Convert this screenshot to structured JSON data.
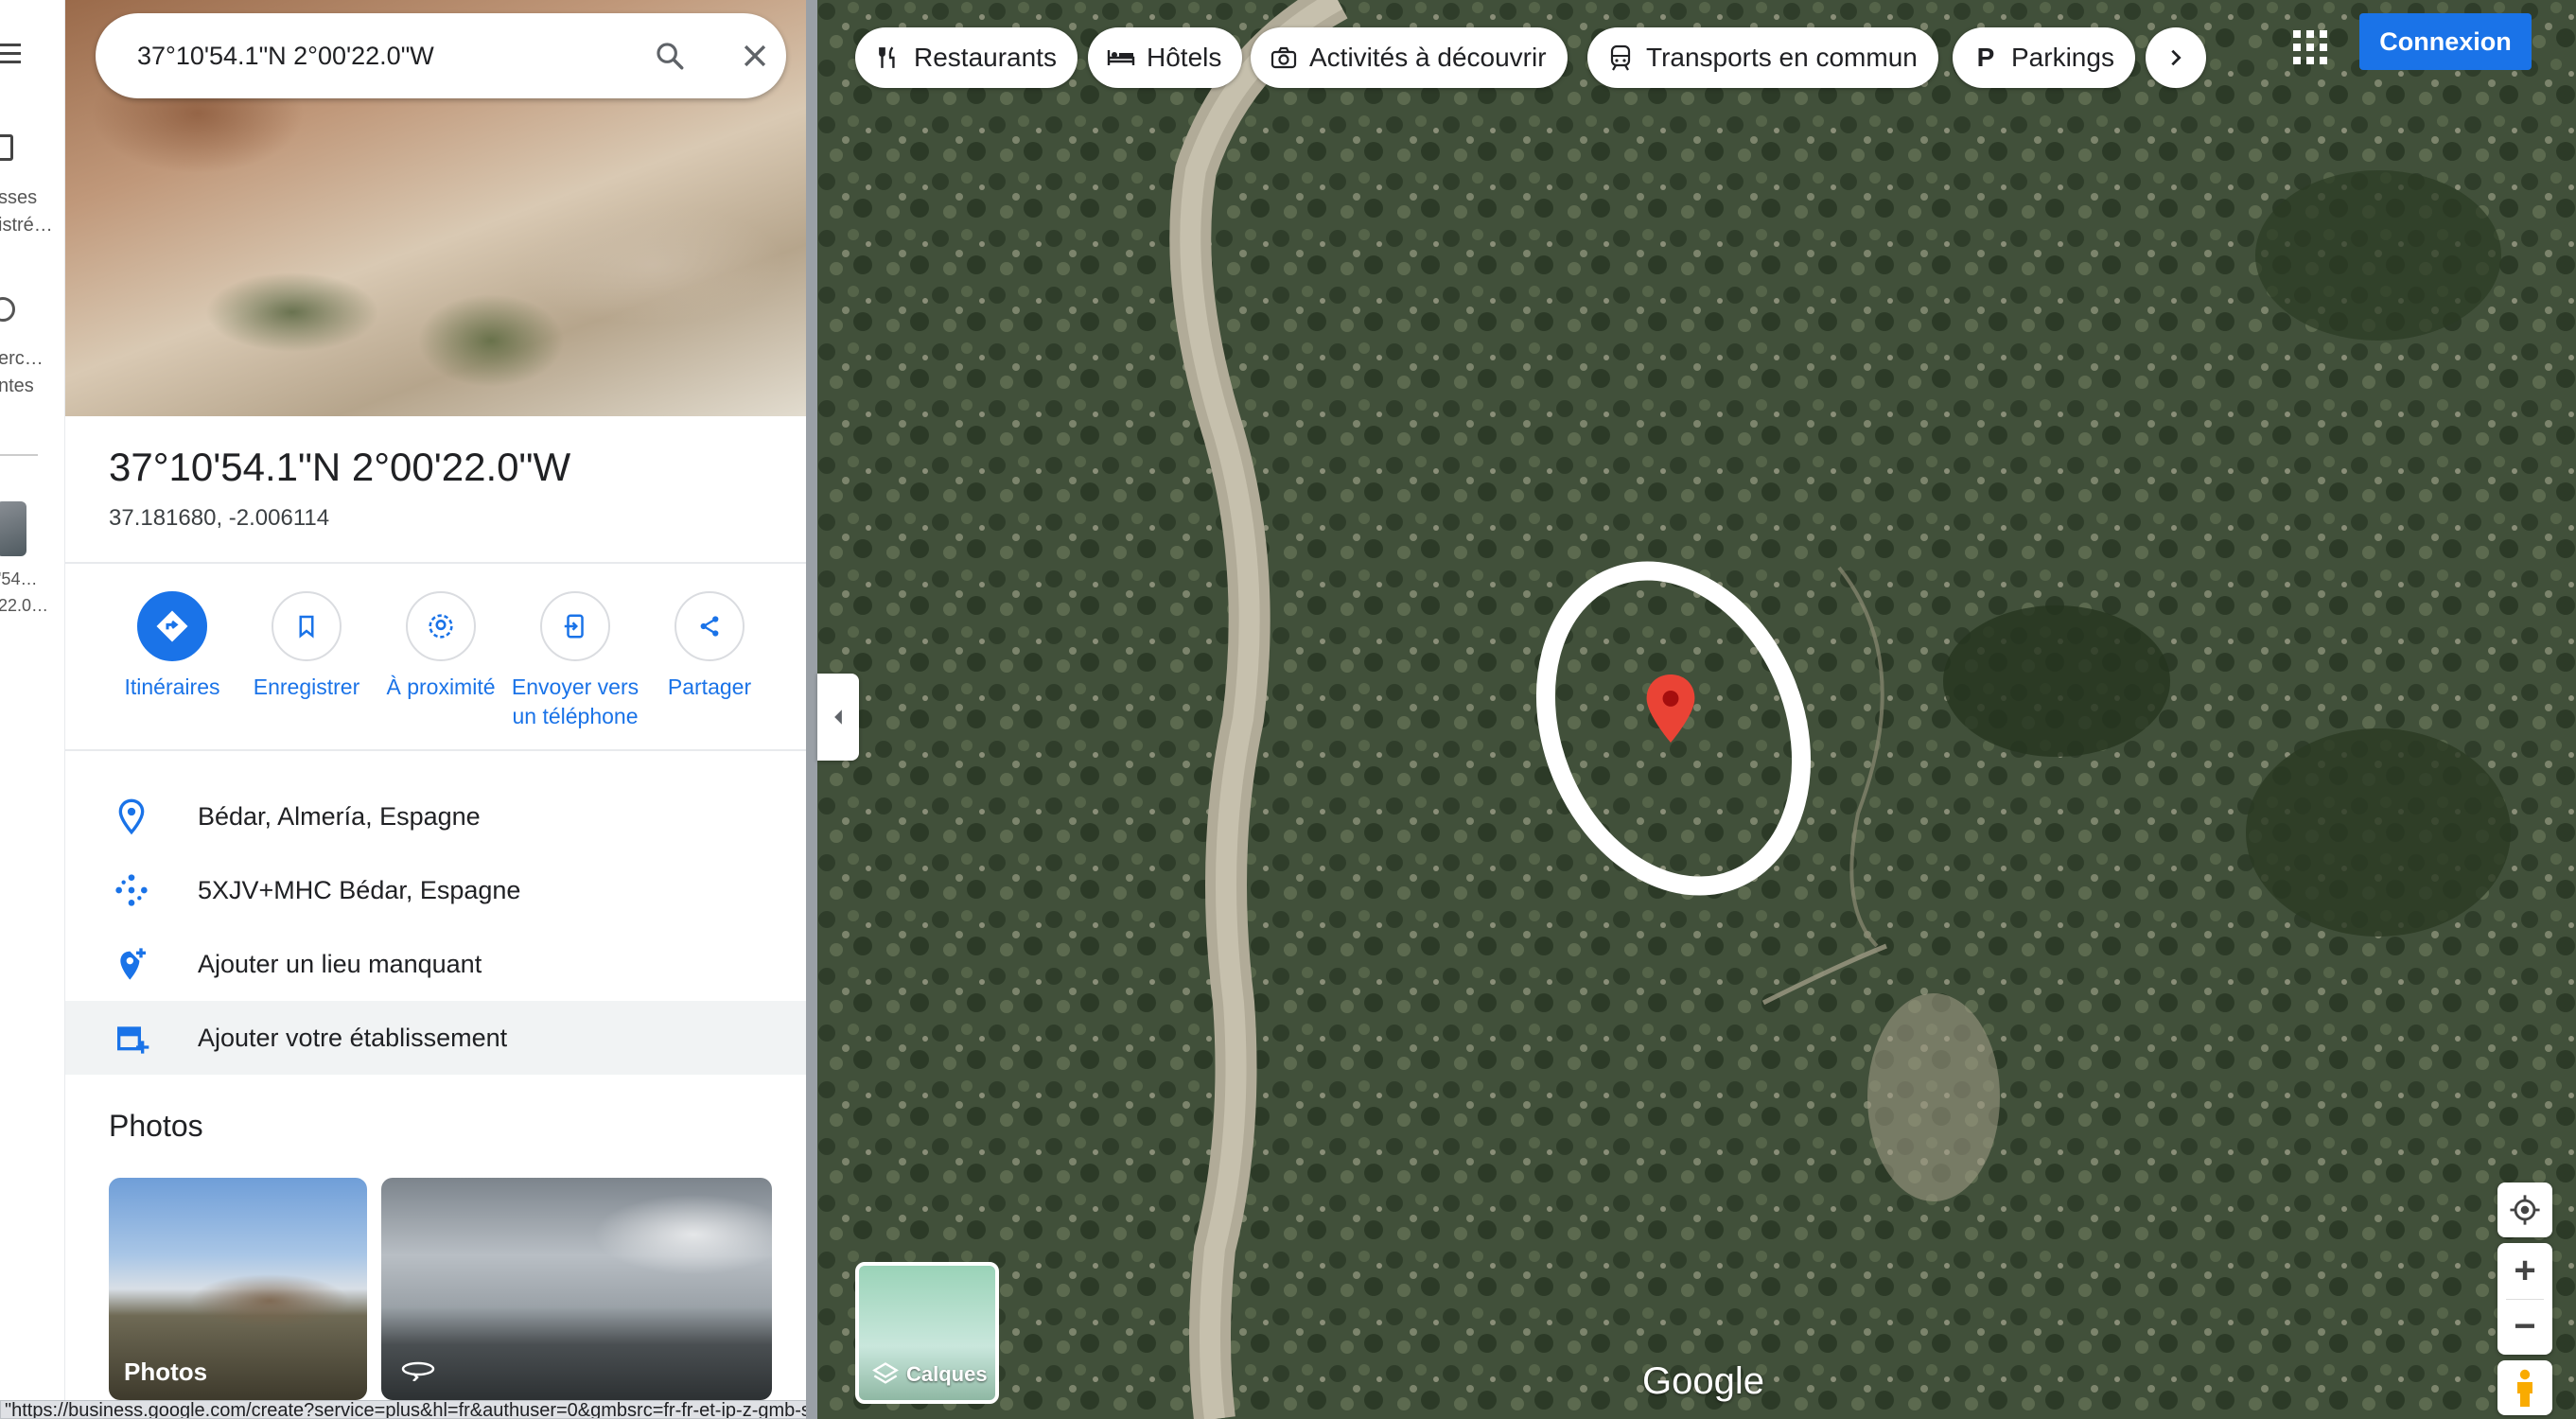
{
  "search": {
    "value": "37°10'54.1\"N 2°00'22.0\"W",
    "search_icon": "search-icon",
    "close_icon": "close-icon"
  },
  "rail": {
    "saved_label": "sses\nistré…",
    "recent_label": "erc…\nntes",
    "recent_item_label": "'54…\n22.0…"
  },
  "place": {
    "title": "37°10'54.1\"N 2°00'22.0\"W",
    "coordinates": "37.181680, -2.006114"
  },
  "actions": [
    {
      "label": "Itinéraires",
      "icon": "directions-icon"
    },
    {
      "label": "Enregistrer",
      "icon": "bookmark-icon"
    },
    {
      "label": "À proximité",
      "icon": "nearby-icon"
    },
    {
      "label": "Envoyer vers un téléphone",
      "icon": "send-to-phone-icon"
    },
    {
      "label": "Partager",
      "icon": "share-icon"
    }
  ],
  "info": [
    {
      "text": "Bédar, Almería, Espagne",
      "icon": "location-pin-icon"
    },
    {
      "text": "5XJV+MHC Bédar, Espagne",
      "icon": "plus-code-icon"
    },
    {
      "text": "Ajouter un lieu manquant",
      "icon": "add-place-icon"
    },
    {
      "text": "Ajouter votre établissement",
      "icon": "add-business-icon"
    }
  ],
  "photos": {
    "heading": "Photos",
    "card1_label": "Photos"
  },
  "status_url": "\"https://business.google.com/create?service=plus&hl=fr&authuser=0&gmbsrc=fr-fr-et-ip-z-gmb-s-z-l~mrc%7Cayb%7Cng&skipIn=1\" in a new tab",
  "map": {
    "chips": [
      {
        "label": "Restaurants",
        "icon": "restaurant-icon"
      },
      {
        "label": "Hôtels",
        "icon": "hotel-icon"
      },
      {
        "label": "Activités à découvrir",
        "icon": "camera-icon"
      },
      {
        "label": "Transports en commun",
        "icon": "transit-icon"
      },
      {
        "label": "Parkings",
        "icon": "parking-icon"
      }
    ],
    "signin_label": "Connexion",
    "layers_label": "Calques",
    "logo": "Google",
    "accent_color": "#1a73e8",
    "pin_color": "#ea4335"
  }
}
